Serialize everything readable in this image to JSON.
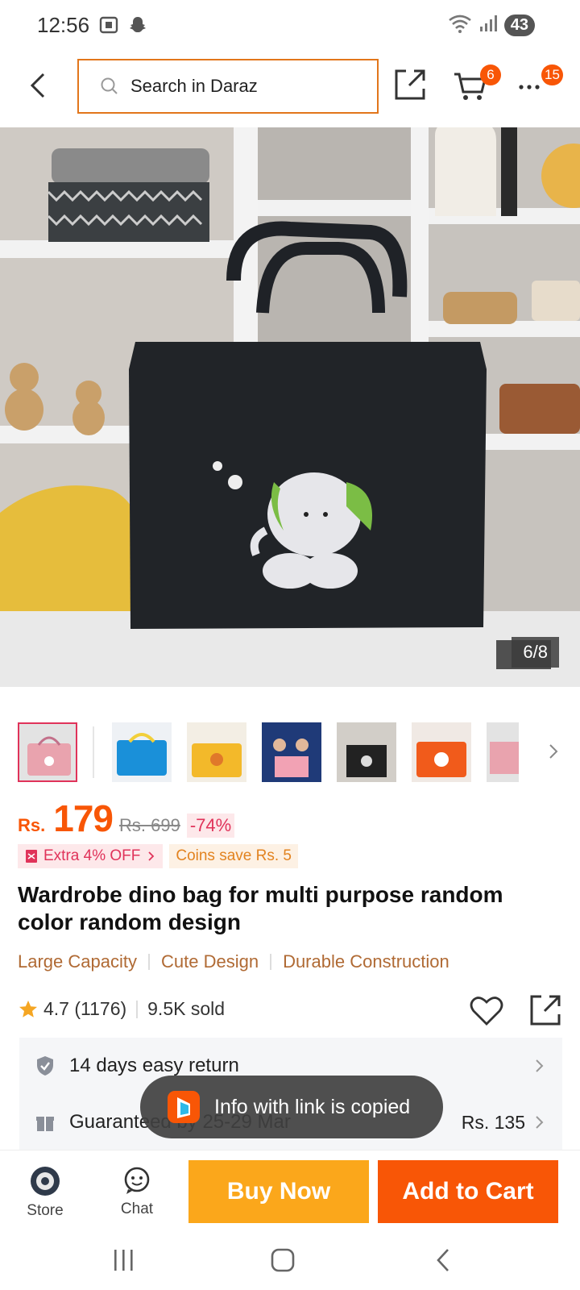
{
  "status_bar": {
    "time": "12:56",
    "battery": "43"
  },
  "header": {
    "search_placeholder": "Search in Daraz",
    "cart_count": "6",
    "more_count": "15"
  },
  "gallery": {
    "counter": "6/8"
  },
  "price": {
    "currency": "Rs.",
    "current": "179",
    "original": "Rs. 699",
    "discount": "-74%"
  },
  "promos": {
    "extra_off": "Extra 4% OFF",
    "coins": "Coins save Rs. 5"
  },
  "product": {
    "title": "Wardrobe dino bag for multi purpose random color random design",
    "tags": [
      "Large Capacity",
      "Cute Design",
      "Durable Construction"
    ],
    "rating": "4.7 (1176)",
    "sold": "9.5K sold"
  },
  "services": {
    "return": "14 days easy return",
    "guarantee": "Guaranteed by 25-29 Mar",
    "delivery_fee": "Rs. 135"
  },
  "toast": {
    "message": "Info with link is copied"
  },
  "action_bar": {
    "store": "Store",
    "chat": "Chat",
    "buy_now": "Buy Now",
    "add_to_cart": "Add to Cart"
  },
  "colors": {
    "brand": "#f85606",
    "buy_now": "#fba71b",
    "search_border": "#e2761b",
    "discount_pink": "#e0335a"
  }
}
